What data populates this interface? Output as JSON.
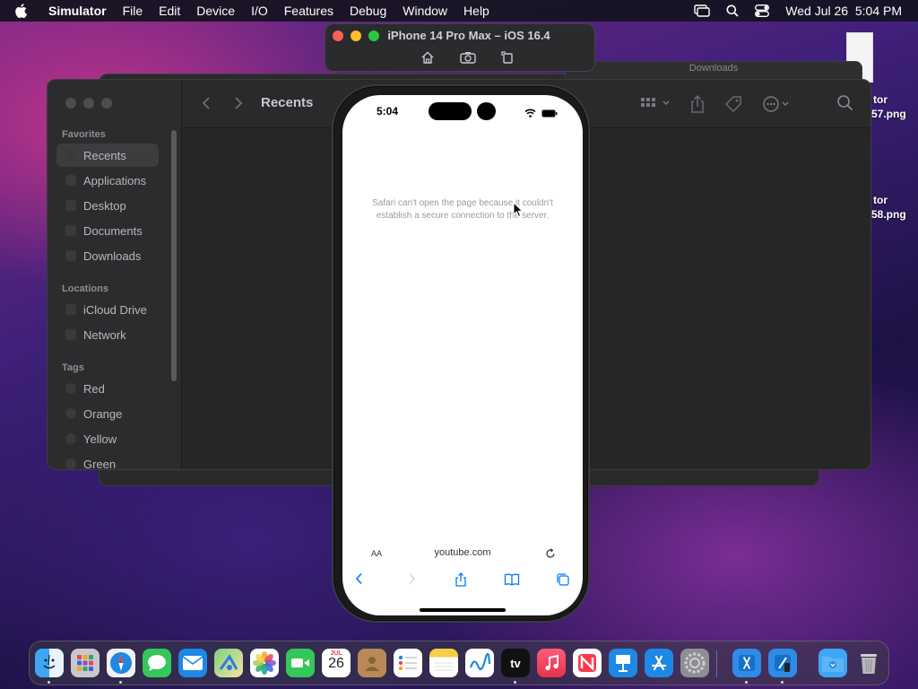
{
  "menubar": {
    "app_name": "Simulator",
    "items": [
      "File",
      "Edit",
      "Device",
      "I/O",
      "Features",
      "Debug",
      "Window",
      "Help"
    ],
    "datetime": "Wed Jul 26  5:04 PM"
  },
  "simulator": {
    "title": "iPhone 14 Pro Max – iOS 16.4"
  },
  "finder": {
    "title": "Recents",
    "back_window_title": "Downloads",
    "favorites_header": "Favorites",
    "favorites": [
      "Recents",
      "Applications",
      "Desktop",
      "Documents",
      "Downloads"
    ],
    "locations_header": "Locations",
    "locations": [
      "iCloud Drive",
      "Network"
    ],
    "tags_header": "Tags",
    "tags": [
      "Red",
      "Orange",
      "Yellow",
      "Green"
    ]
  },
  "phone": {
    "time": "5:04",
    "error_message": "Safari can't open the page because it couldn't establish a secure connection to the server.",
    "text_size_label": "AA",
    "url": "youtube.com"
  },
  "desktop": {
    "files": [
      {
        "label_top": "tor",
        "label_bottom": "57.png"
      },
      {
        "label_top": "tor",
        "label_bottom": "58.png"
      }
    ]
  },
  "dock": {
    "calendar_month": "JUL",
    "calendar_day": "26",
    "tv_label": "tv",
    "apps": [
      "Finder",
      "Launchpad",
      "Safari",
      "Messages",
      "Mail",
      "Maps",
      "Photos",
      "FaceTime",
      "Calendar",
      "Contacts",
      "Reminders",
      "Notes",
      "Freeform",
      "TV",
      "Music",
      "News",
      "Keynote",
      "App Store",
      "System Settings",
      "Xcode",
      "Simulator",
      "Downloads",
      "Trash"
    ]
  },
  "colors": {
    "close": "#ff5f57",
    "minimize": "#febc2e",
    "zoom": "#28c840",
    "ios_blue": "#007aff"
  }
}
